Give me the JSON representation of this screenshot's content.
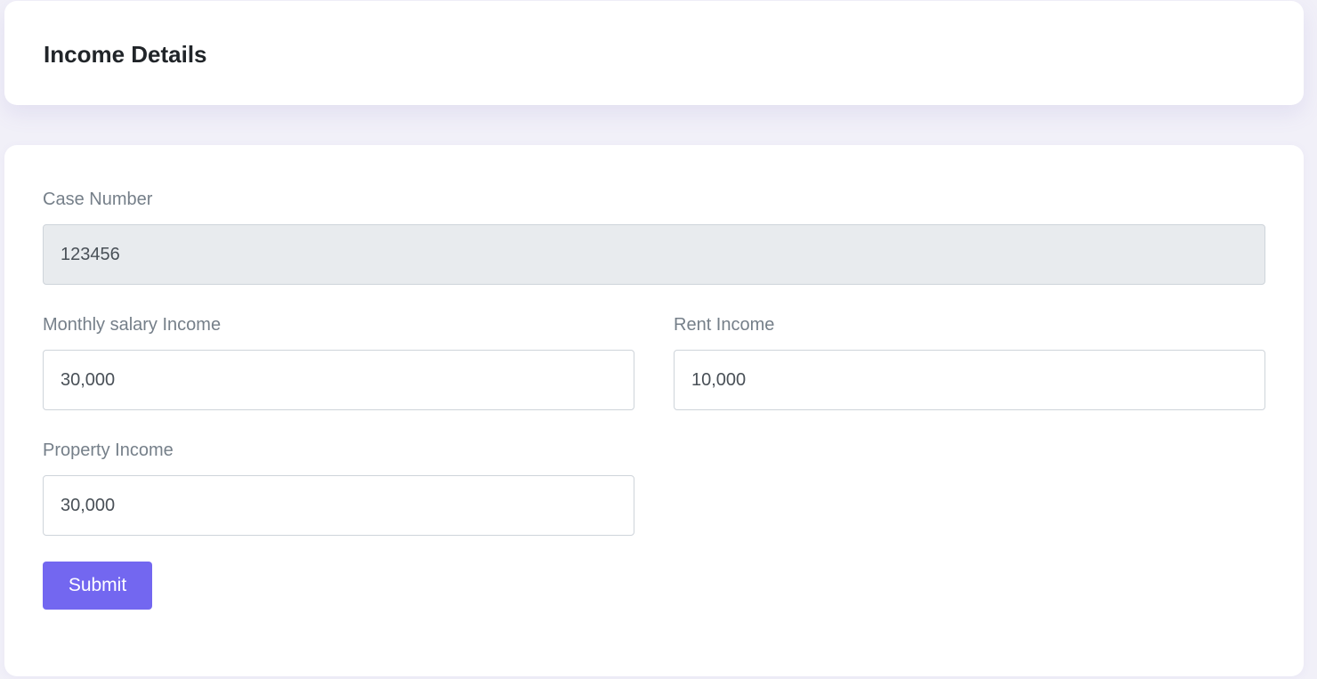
{
  "header": {
    "title": "Income Details"
  },
  "form": {
    "case_number": {
      "label": "Case Number",
      "value": "123456",
      "readonly": true
    },
    "monthly_salary": {
      "label": "Monthly salary Income",
      "value": "30,000"
    },
    "rent_income": {
      "label": "Rent Income",
      "value": "10,000"
    },
    "property_income": {
      "label": "Property Income",
      "value": "30,000"
    },
    "submit_label": "Submit"
  },
  "colors": {
    "accent": "#7367f0",
    "page_background": "#f1f0f8",
    "readonly_input_background": "#e8ebee",
    "label_text": "#757f89",
    "title_text": "#212529"
  }
}
